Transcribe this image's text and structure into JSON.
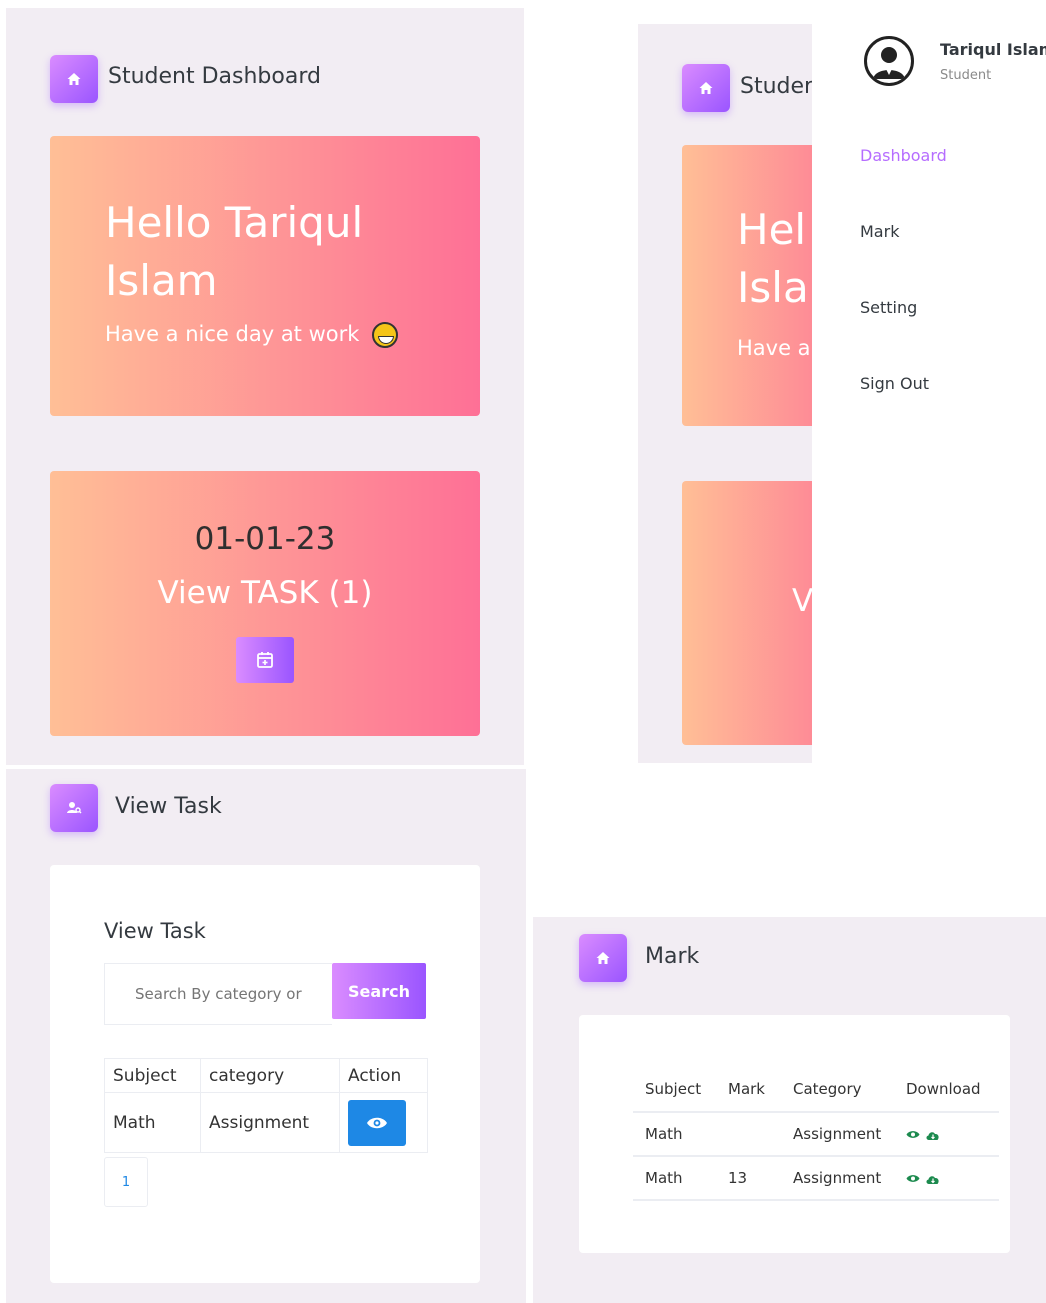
{
  "dashboard": {
    "title": "Student Dashboard",
    "greeting": "Hello Tariqul Islam",
    "greeting_line1": "Hello Tariqul",
    "greeting_line2": "Islam",
    "subtitle": "Have a nice day at work",
    "task_date": "01-01-23",
    "task_label": "View TASK (1)",
    "icons": {
      "header": "home-icon",
      "calendar": "calendar-plus-icon",
      "emoji": "grinning-face-icon"
    }
  },
  "sidebar": {
    "user_name": "Tariqul Islam",
    "user_role": "Student",
    "partial_title": "Studer",
    "partial_hello_1": "Hel",
    "partial_hello_2": "Isla",
    "partial_nice": "Have a",
    "partial_view": "V",
    "items": [
      {
        "label": "Dashboard",
        "active": true
      },
      {
        "label": "Mark",
        "active": false
      },
      {
        "label": "Setting",
        "active": false
      },
      {
        "label": "Sign Out",
        "active": false
      }
    ],
    "active_color": "#b66dff"
  },
  "view_task": {
    "title": "View Task",
    "card_title": "View Task",
    "search_placeholder": "Search By category or",
    "search_button": "Search",
    "columns": [
      "Subject",
      "category",
      "Action"
    ],
    "rows": [
      {
        "subject": "Math",
        "category": "Assignment",
        "action_icon": "eye-icon"
      }
    ],
    "pagination": [
      "1"
    ]
  },
  "mark": {
    "title": "Mark",
    "columns": [
      "Subject",
      "Mark",
      "Category",
      "Download"
    ],
    "rows": [
      {
        "subject": "Math",
        "mark": "",
        "category": "Assignment"
      },
      {
        "subject": "Math",
        "mark": "13",
        "category": "Assignment"
      }
    ],
    "download_icons": [
      "eye-icon",
      "cloud-download-icon"
    ]
  },
  "colors": {
    "accent": "#9a55ff",
    "accent_light": "#da8cff",
    "card_gradient_start": "#ffbf96",
    "card_gradient_end": "#fe7096",
    "panel_bg": "#f2edf3",
    "view_button": "#1e88e5",
    "download_icon": "#1c8a4e"
  }
}
